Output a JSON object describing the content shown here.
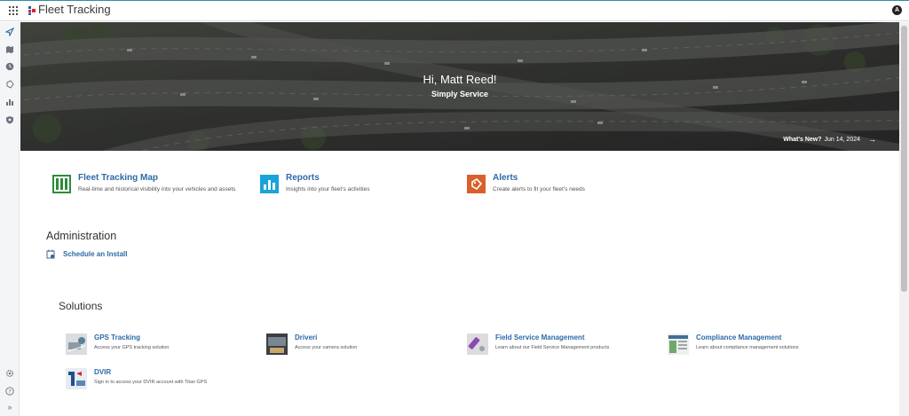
{
  "header": {
    "app_title": "Fleet Tracking",
    "user_initial": "A"
  },
  "sidebar": {
    "icons": [
      "navigation-icon",
      "map-icon",
      "clock-icon",
      "alert-tag-icon",
      "reports-icon",
      "shield-icon"
    ],
    "bottom_icons": [
      "settings-icon",
      "help-icon",
      "expand-icon"
    ],
    "expand_glyph": "»"
  },
  "hero": {
    "greeting": "Hi, Matt Reed!",
    "subtitle": "Simply Service",
    "whats_new_label": "What's New?",
    "whats_new_date": "Jun 14, 2024",
    "arrow": "→"
  },
  "features": [
    {
      "title": "Fleet Tracking Map",
      "description": "Real-time and historical visibility into your vehicles and assets",
      "icon": "map-icon",
      "color": "#2e8b3c"
    },
    {
      "title": "Reports",
      "description": "Insights into your fleet's activities",
      "icon": "reports-icon",
      "color": "#1aa3d9"
    },
    {
      "title": "Alerts",
      "description": "Create alerts to fit your fleet's needs",
      "icon": "alert-icon",
      "color": "#d9602b"
    }
  ],
  "administration": {
    "title": "Administration",
    "link": "Schedule an Install"
  },
  "solutions": {
    "title": "Solutions",
    "items": [
      {
        "title": "GPS Tracking",
        "description": "Access your GPS tracking solution"
      },
      {
        "title": "Driveri",
        "description": "Access your camera solution"
      },
      {
        "title": "Field Service Management",
        "description": "Learn about our Field Service Management products"
      },
      {
        "title": "Compliance Management",
        "description": "Learn about compliance management solutions"
      },
      {
        "title": "DVIR",
        "description": "Sign in to access your DVIR account with Titan GPS"
      }
    ]
  },
  "colors": {
    "link": "#2d6aa8",
    "topbar_accent": "#2d8fa8"
  }
}
